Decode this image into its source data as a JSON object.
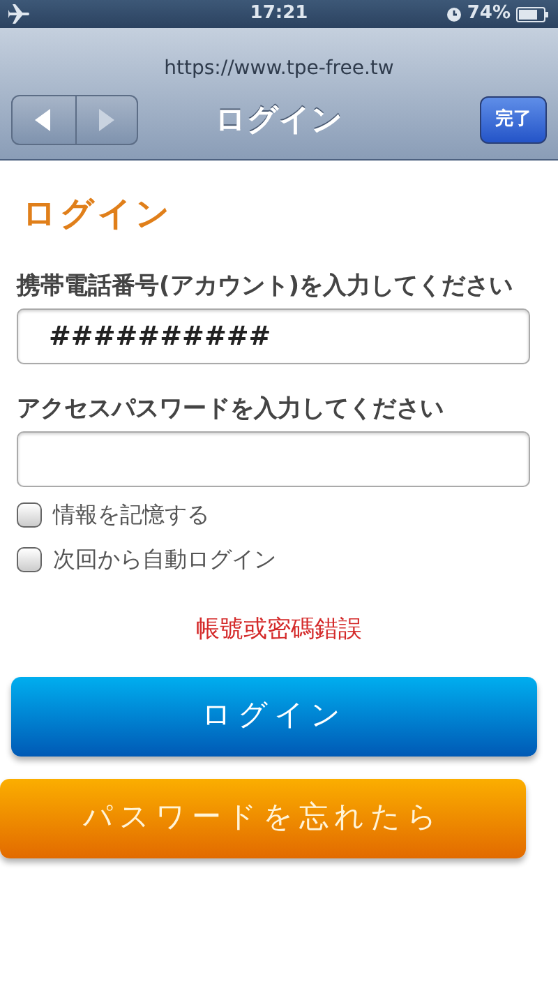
{
  "status_bar": {
    "time": "17:21",
    "battery": "74%"
  },
  "browser": {
    "url": "https://www.tpe-free.tw",
    "title": "ログイン",
    "done_button": "完了",
    "nav_buttons": [
      {
        "kind": "back",
        "disabled": false
      },
      {
        "kind": "forward",
        "disabled": true
      }
    ]
  },
  "page": {
    "heading": "ログイン",
    "fields": [
      {
        "label": "携帯電話番号(アカウント)を入力してください",
        "value": "##########"
      },
      {
        "label": "アクセスパスワードを入力してください"
      }
    ],
    "checkboxes": [
      {
        "label": "情報を記憶する",
        "checked": false
      },
      {
        "label": "次回から自動ログイン",
        "checked": false
      }
    ],
    "error": "帳號或密碼錯誤",
    "buttons": [
      {
        "kind": "primary",
        "label": "ログイン"
      },
      {
        "kind": "secondary",
        "label": "パスワードを忘れたら"
      }
    ]
  }
}
